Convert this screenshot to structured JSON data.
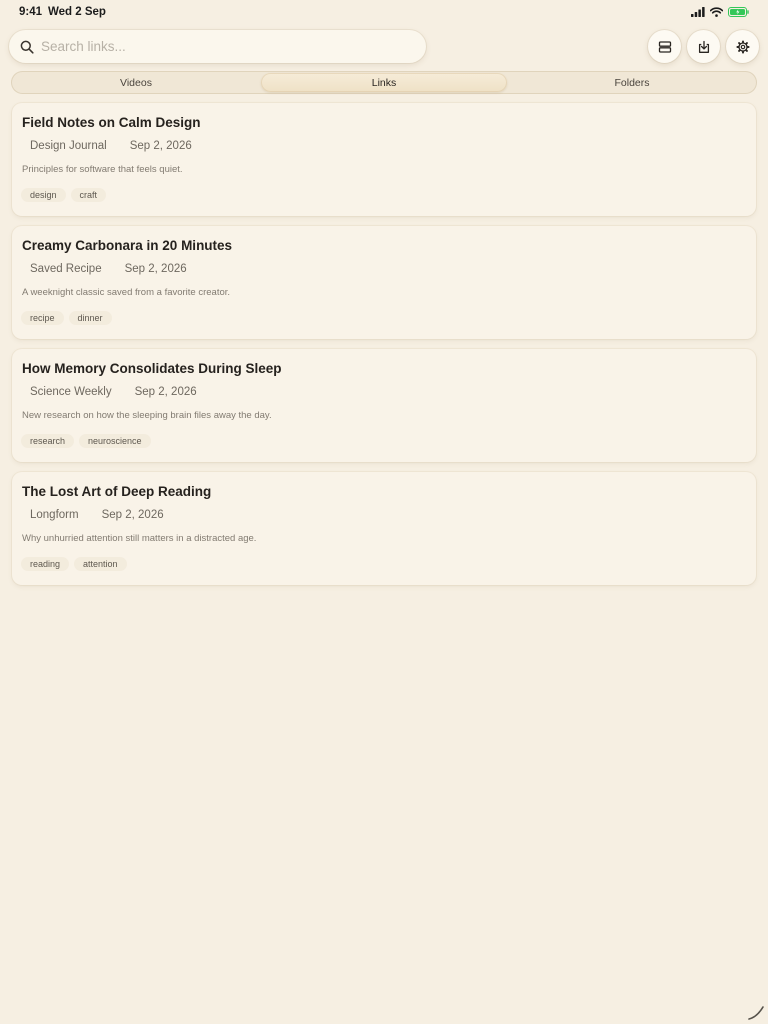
{
  "status_bar": {
    "time": "9:41",
    "date": "Wed 2 Sep"
  },
  "search": {
    "placeholder": "Search links..."
  },
  "tabs": [
    {
      "label": "Videos",
      "active": false
    },
    {
      "label": "Links",
      "active": true
    },
    {
      "label": "Folders",
      "active": false
    }
  ],
  "links": [
    {
      "title": "Field Notes on Calm Design",
      "source": "Design Journal",
      "date": "Sep 2, 2026",
      "description": "Principles for software that feels quiet.",
      "tags": [
        "design",
        "craft"
      ]
    },
    {
      "title": "Creamy Carbonara in 20 Minutes",
      "source": "Saved Recipe",
      "date": "Sep 2, 2026",
      "description": "A weeknight classic saved from a favorite creator.",
      "tags": [
        "recipe",
        "dinner"
      ]
    },
    {
      "title": "How Memory Consolidates During Sleep",
      "source": "Science Weekly",
      "date": "Sep 2, 2026",
      "description": "New research on how the sleeping brain files away the day.",
      "tags": [
        "research",
        "neuroscience"
      ]
    },
    {
      "title": "The Lost Art of Deep Reading",
      "source": "Longform",
      "date": "Sep 2, 2026",
      "description": "Why unhurried attention still matters in a distracted age.",
      "tags": [
        "reading",
        "attention"
      ]
    }
  ],
  "colors": {
    "background": "#f6efe2",
    "card": "#f9f3e8",
    "battery": "#34c759"
  },
  "icons": [
    "search-icon",
    "layout-toggle-icon",
    "import-icon",
    "gear-icon",
    "cellular-icon",
    "wifi-icon",
    "battery-icon"
  ]
}
